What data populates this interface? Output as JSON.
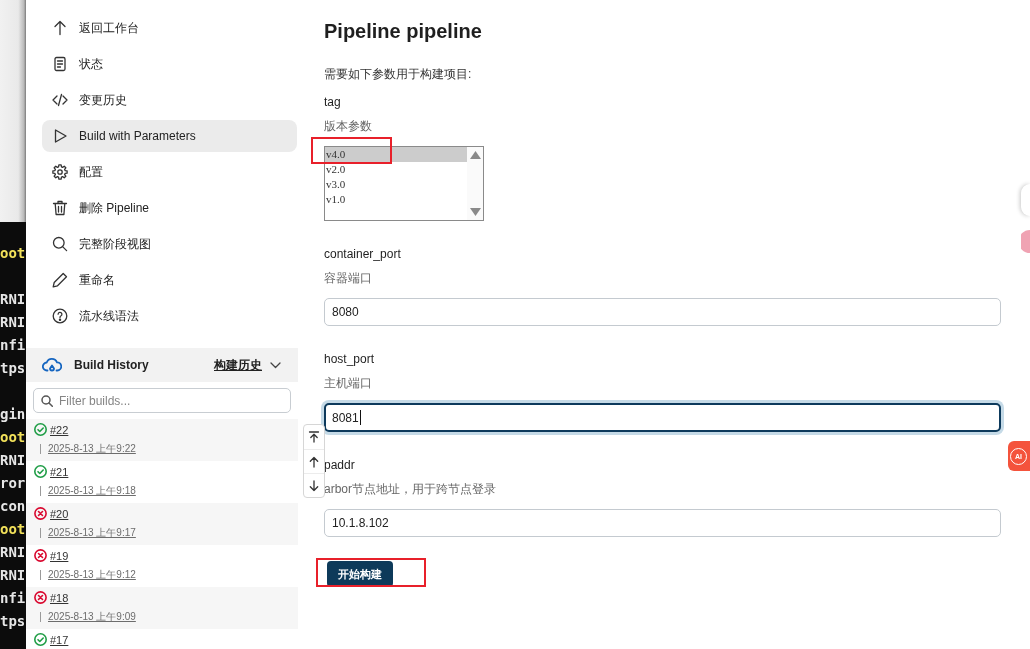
{
  "background": {
    "terminal_blocks": [
      [
        {
          "text": "oot",
          "kind": "prompt"
        }
      ],
      [
        {
          "text": "RNI",
          "kind": "log"
        },
        {
          "text": "RNI",
          "kind": "log"
        },
        {
          "text": "nfi",
          "kind": "log"
        },
        {
          "text": "tps",
          "kind": "log"
        }
      ],
      [
        {
          "text": "gin",
          "kind": "log"
        },
        {
          "text": "oot",
          "kind": "prompt"
        },
        {
          "text": "RNI",
          "kind": "log"
        },
        {
          "text": "ror",
          "kind": "log"
        },
        {
          "text": "con",
          "kind": "log"
        },
        {
          "text": "oot",
          "kind": "prompt"
        },
        {
          "text": "RNI",
          "kind": "log"
        },
        {
          "text": "RNI",
          "kind": "log"
        },
        {
          "text": "nfi",
          "kind": "log"
        },
        {
          "text": "tps",
          "kind": "log"
        }
      ]
    ]
  },
  "sidebar": {
    "items": [
      {
        "label": "返回工作台",
        "selected": false
      },
      {
        "label": "状态",
        "selected": false
      },
      {
        "label": "变更历史",
        "selected": false
      },
      {
        "label": "Build with Parameters",
        "selected": true
      },
      {
        "label": "配置",
        "selected": false
      },
      {
        "label": "删除 Pipeline",
        "selected": false
      },
      {
        "label": "完整阶段视图",
        "selected": false
      },
      {
        "label": "重命名",
        "selected": false
      },
      {
        "label": "流水线语法",
        "selected": false
      }
    ]
  },
  "build_history": {
    "title": "Build History",
    "link": "构建历史",
    "filter": {
      "placeholder": "Filter builds..."
    },
    "builds": [
      {
        "number": "#22",
        "kind": "success",
        "date": "2025-8-13 上午9:22"
      },
      {
        "number": "#21",
        "kind": "success",
        "date": "2025-8-13 上午9:18"
      },
      {
        "number": "#20",
        "kind": "failure",
        "date": "2025-8-13 上午9:17"
      },
      {
        "number": "#19",
        "kind": "failure",
        "date": "2025-8-13 上午9:12"
      },
      {
        "number": "#18",
        "kind": "failure",
        "date": "2025-8-13 上午9:09"
      },
      {
        "number": "#17",
        "kind": "success"
      }
    ]
  },
  "main": {
    "title": "Pipeline pipeline",
    "intro": "需要如下参数用于构建项目:",
    "parameters": [
      {
        "kind": "choice",
        "name": "tag",
        "description": "版本参数",
        "options": [
          {
            "label": "v4.0",
            "selected": true,
            "annotated": true
          },
          {
            "label": "v2.0",
            "selected": false,
            "annotated": false
          },
          {
            "label": "v3.0",
            "selected": false,
            "annotated": false
          },
          {
            "label": "v1.0",
            "selected": false,
            "annotated": false
          }
        ]
      },
      {
        "kind": "text",
        "name": "container_port",
        "description": "容器端口",
        "value": "8080",
        "focused": false
      },
      {
        "kind": "text",
        "name": "host_port",
        "description": "主机端口",
        "value": "8081",
        "focused": true
      },
      {
        "kind": "text",
        "name": "paddr",
        "description": "arbor节点地址，用于跨节点登录",
        "value": "10.1.8.102",
        "focused": false
      }
    ],
    "submit": {
      "label": "开始构建",
      "annotated": true
    }
  },
  "floating_tools": {
    "ai_label": "AI"
  }
}
